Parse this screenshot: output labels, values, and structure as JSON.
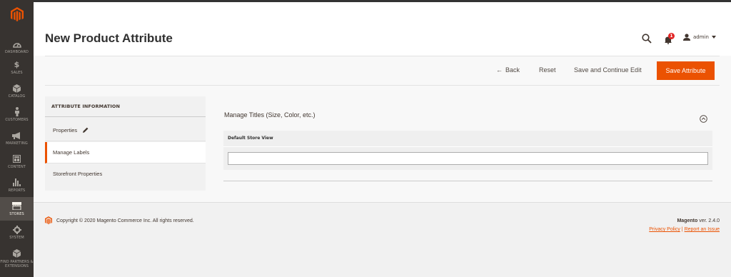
{
  "nav": {
    "items": [
      {
        "label": "DASHBOARD",
        "icon": "dashboard-icon"
      },
      {
        "label": "SALES",
        "icon": "dollar-icon"
      },
      {
        "label": "CATALOG",
        "icon": "cube-icon"
      },
      {
        "label": "CUSTOMERS",
        "icon": "person-icon"
      },
      {
        "label": "MARKETING",
        "icon": "megaphone-icon"
      },
      {
        "label": "CONTENT",
        "icon": "layout-icon"
      },
      {
        "label": "REPORTS",
        "icon": "bar-chart-icon"
      },
      {
        "label": "STORES",
        "icon": "store-icon"
      },
      {
        "label": "SYSTEM",
        "icon": "gear-icon"
      },
      {
        "label": "FIND PARTNERS & EXTENSIONS",
        "icon": "cube-box-icon"
      }
    ],
    "active": "STORES"
  },
  "header": {
    "title": "New Product Attribute",
    "notifications_count": "1",
    "user": "admin"
  },
  "actions": {
    "back": "Back",
    "reset": "Reset",
    "save_continue": "Save and Continue Edit",
    "save": "Save Attribute"
  },
  "tabs": {
    "title": "ATTRIBUTE INFORMATION",
    "items": [
      {
        "label": "Properties"
      },
      {
        "label": "Manage Labels"
      },
      {
        "label": "Storefront Properties"
      }
    ]
  },
  "section": {
    "title": "Manage Titles (Size, Color, etc.)",
    "column_header": "Default Store View",
    "input_value": ""
  },
  "footer": {
    "copyright": "Copyright © 2020 Magento Commerce Inc. All rights reserved.",
    "brand": "Magento",
    "version": "ver. 2.4.0",
    "privacy": "Privacy Policy",
    "separator": "|",
    "report": "Report an Issue"
  },
  "colors": {
    "accent": "#eb5202",
    "sidebar": "#373330"
  }
}
